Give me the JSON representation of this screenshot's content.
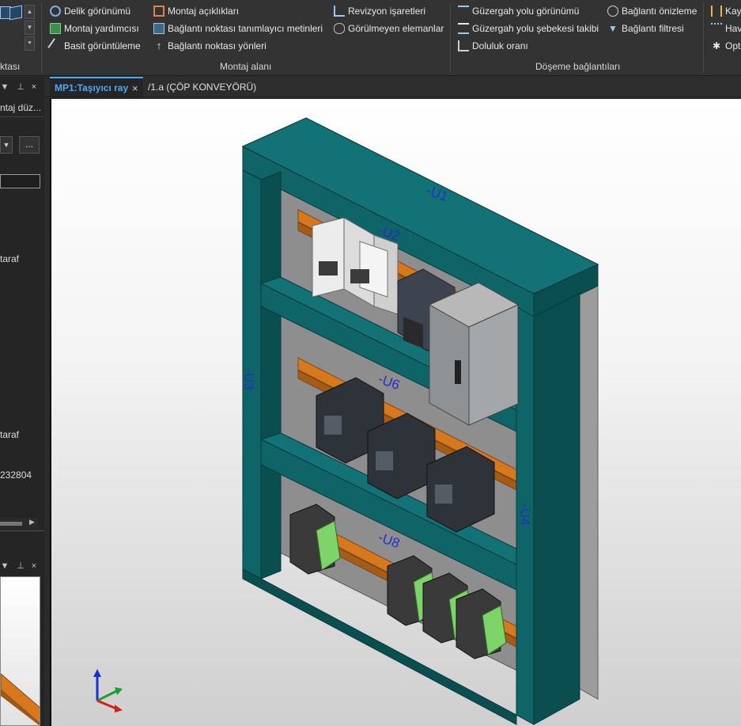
{
  "ribbon": {
    "group1": {
      "label": "ktası"
    },
    "group2": {
      "items": [
        "Delik görünümü",
        "Montaj yardımcısı",
        "Basit görüntüleme"
      ]
    },
    "group3": {
      "items": [
        "Montaj açıklıkları",
        "Bağlantı noktası tanımlayıcı metinleri",
        "Bağlantı noktası yönleri"
      ]
    },
    "group4": {
      "label": "Montaj alanı",
      "items": [
        "Revizyon işaretleri",
        "Görülmeyen elemanlar"
      ]
    },
    "group5": {
      "label": "Döşeme bağlantıları",
      "items": [
        "Güzergah yolu görünümü",
        "Güzergah yolu şebekesi takibi",
        "Doluluk oranı",
        "Bağlantı önizleme",
        "Bağlantı filtresi"
      ]
    },
    "group6": {
      "items": [
        "Kay",
        "Hav",
        "Opt"
      ]
    }
  },
  "tabs": {
    "active": "MP1:Taşıyıcı ray",
    "close_glyph": "×",
    "second": "/1.a (ÇÖP KONVEYÖRÜ)"
  },
  "left_panel": {
    "title": "ntaj düz...",
    "ellipsis": "...",
    "row1": "taraf",
    "row2": "taraf",
    "row3": "232804",
    "header_glyphs": "▼ ⊥ ×"
  },
  "model_labels": {
    "u1": "-U1",
    "u2": "-U2",
    "u3": "-U3",
    "u4": "-U4",
    "u6": "-U6",
    "u8": "-U8"
  },
  "colors": {
    "cabinet": "#0e6466",
    "cabinet_dark": "#0a4e50",
    "cabinet_light": "#137275",
    "rail": "#d8781e",
    "terminal_green": "#7fd36b",
    "accent_tab": "#4aa8ff"
  }
}
